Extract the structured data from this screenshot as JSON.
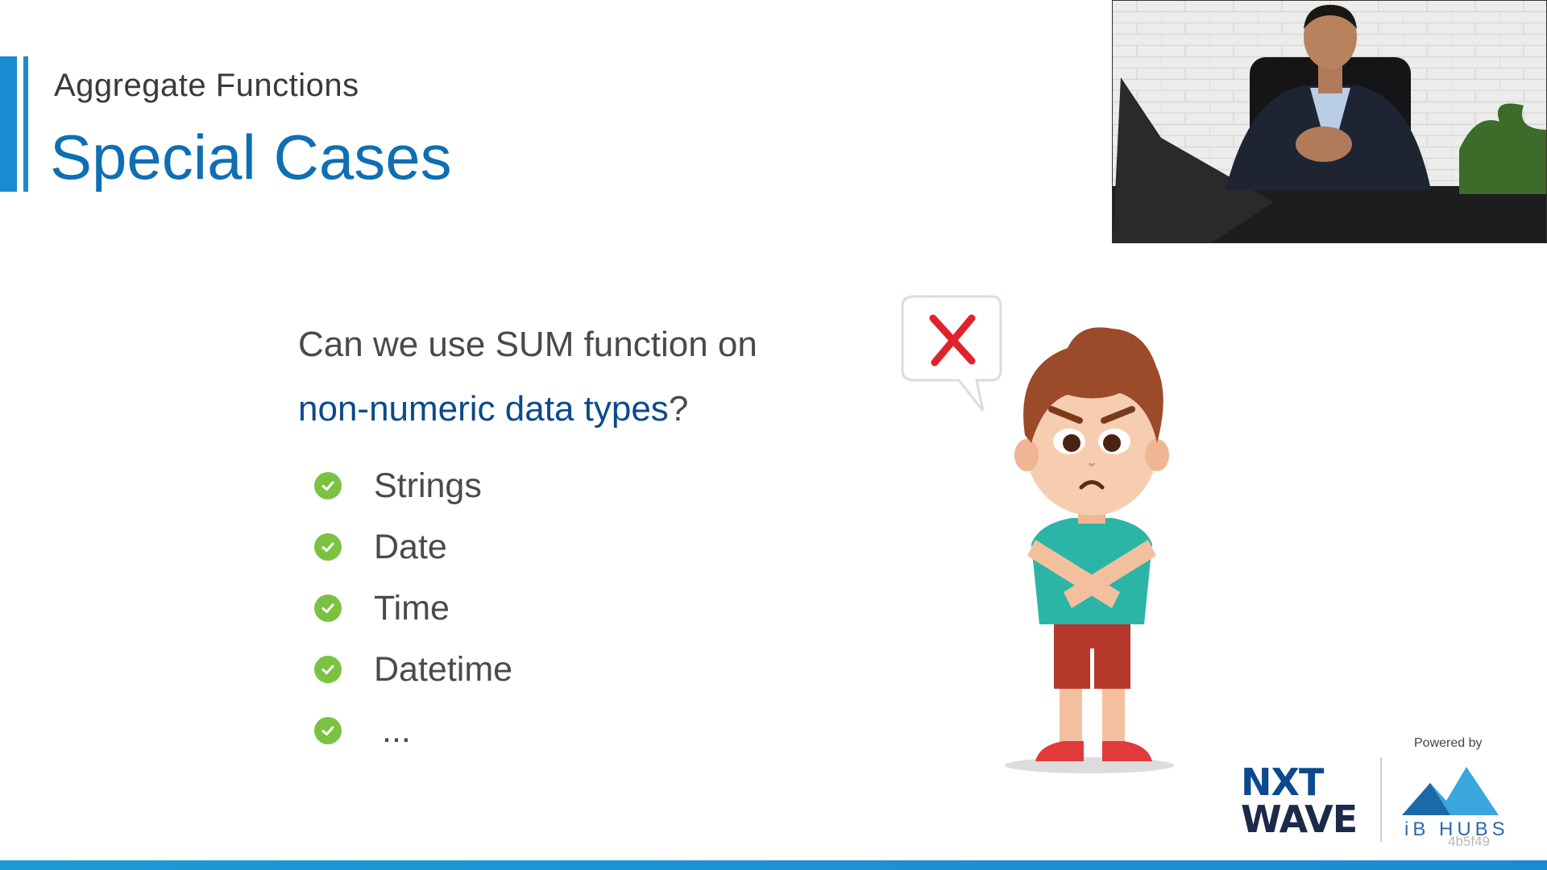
{
  "slide": {
    "subtitle": "Aggregate Functions",
    "title": "Special Cases",
    "question_line1": "Can we use SUM function on",
    "question_highlight": "non-numeric data types",
    "question_end": "?",
    "items": [
      "Strings",
      "Date",
      "Time",
      "Datetime",
      "..."
    ]
  },
  "branding": {
    "powered_by": "Powered by",
    "nxt": "NXT",
    "wave": "WAVE",
    "ibhubs": "iB HUBS",
    "watermark": "4b5f49"
  },
  "colors": {
    "accent": "#1a8bd0",
    "title": "#0e6fb3",
    "highlight": "#0b4a8c",
    "check": "#7cc242"
  },
  "icons": [
    "check-circle-icon",
    "cross-icon",
    "webcam-feed",
    "boy-illustration",
    "ibhubs-logo-icon"
  ]
}
